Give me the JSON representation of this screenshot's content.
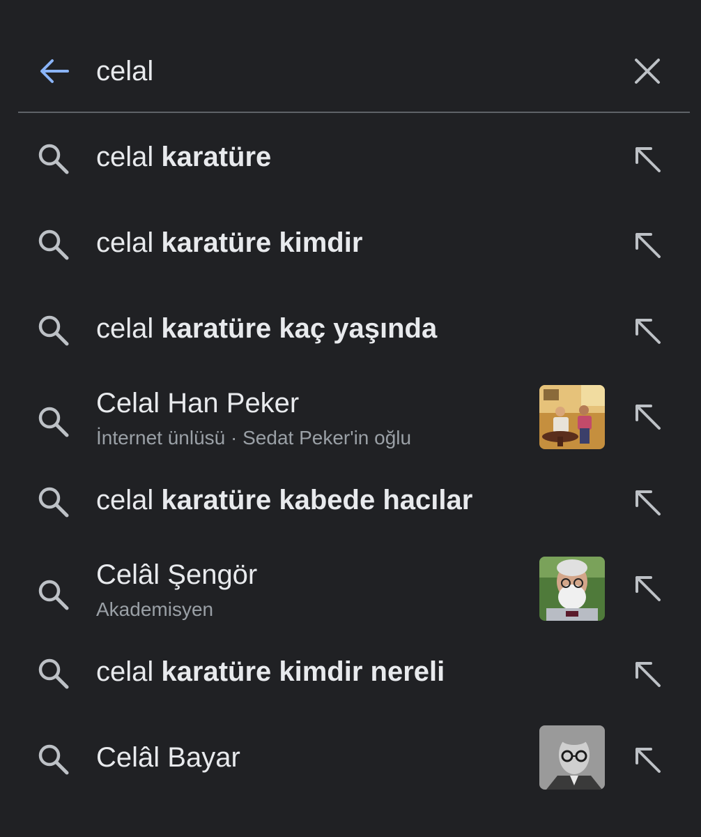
{
  "search": {
    "query": "celal",
    "back_icon": "arrow-back-icon",
    "clear_icon": "close-icon",
    "accent_color": "#8ab4f8"
  },
  "suggestions": [
    {
      "type": "query",
      "prefix": "celal ",
      "completion": "karatüre"
    },
    {
      "type": "query",
      "prefix": "celal ",
      "completion": "karatüre kimdir"
    },
    {
      "type": "query",
      "prefix": "celal ",
      "completion": "karatüre kaç yaşında"
    },
    {
      "type": "entity",
      "title": "Celal Han Peker",
      "subtitle": "İnternet ünlüsü · Sedat Peker'in oğlu",
      "thumbnail": "photo-thumbnail"
    },
    {
      "type": "query",
      "prefix": "celal ",
      "completion": "karatüre kabede hacılar"
    },
    {
      "type": "entity",
      "title": "Celâl Şengör",
      "subtitle": "Akademisyen",
      "thumbnail": "photo-thumbnail"
    },
    {
      "type": "query",
      "prefix": "celal ",
      "completion": "karatüre kimdir nereli"
    },
    {
      "type": "entity",
      "title": "Celâl Bayar",
      "subtitle": "",
      "thumbnail": "photo-thumbnail"
    }
  ]
}
